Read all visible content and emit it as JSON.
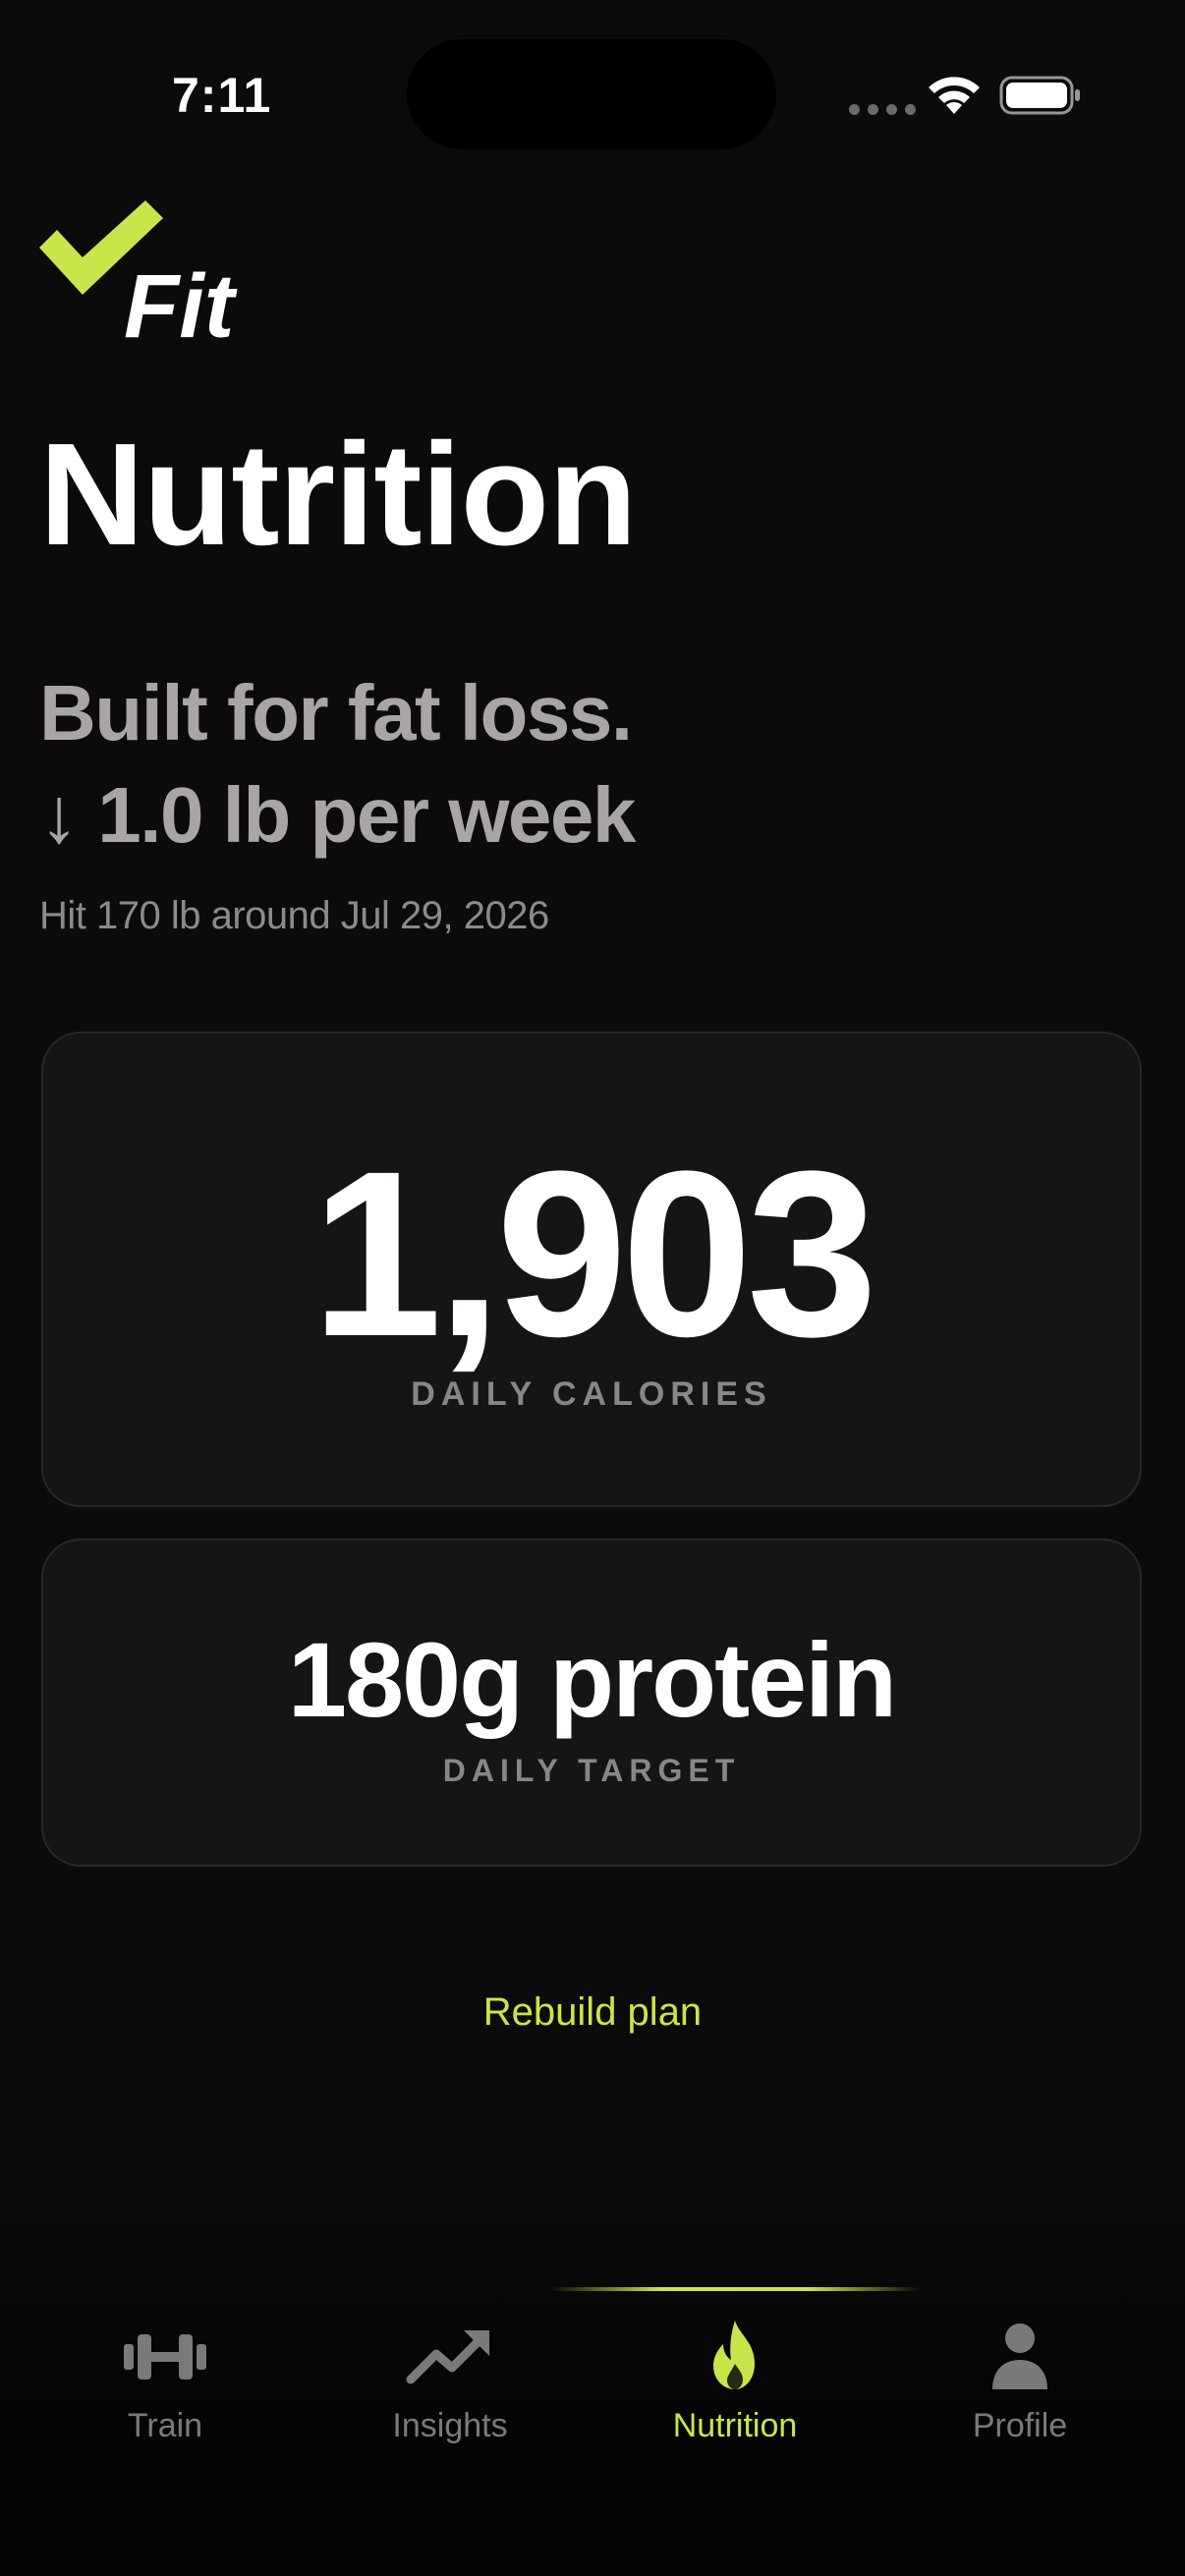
{
  "status_bar": {
    "time": "7:11"
  },
  "brand": {
    "logo_text": "Fit",
    "accent_color": "#c8e64a"
  },
  "header": {
    "title": "Nutrition",
    "goal_line_1": "Built for fat loss.",
    "goal_line_2": "↓ 1.0 lb per week",
    "goal_date": "Hit 170 lb around Jul 29, 2026"
  },
  "calories_card": {
    "value": "1,903",
    "label": "DAILY CALORIES"
  },
  "protein_card": {
    "value": "180g protein",
    "label": "DAILY TARGET"
  },
  "actions": {
    "rebuild_label": "Rebuild plan"
  },
  "tab_bar": {
    "active": "Nutrition",
    "tabs": [
      {
        "label": "Train",
        "icon": "dumbbell-icon"
      },
      {
        "label": "Insights",
        "icon": "trending-up-icon"
      },
      {
        "label": "Nutrition",
        "icon": "flame-icon"
      },
      {
        "label": "Profile",
        "icon": "person-icon"
      }
    ]
  }
}
